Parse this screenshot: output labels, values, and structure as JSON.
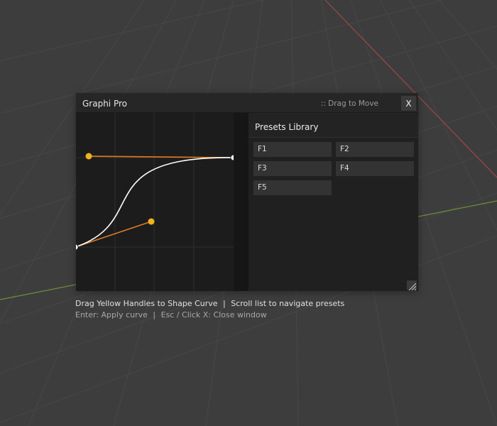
{
  "window": {
    "title": "Graphi Pro",
    "drag_hint": ":: Drag to Move",
    "close_label": "X"
  },
  "curve_editor": {
    "handle_color": "#f2b21e",
    "curve_color": "#ffffff",
    "handle_line_color": "#e07b1f"
  },
  "presets": {
    "title": "Presets Library",
    "items": [
      {
        "label": "F1"
      },
      {
        "label": "F2"
      },
      {
        "label": "F3"
      },
      {
        "label": "F4"
      },
      {
        "label": "F5"
      }
    ]
  },
  "status": {
    "line1_part1": "Drag Yellow Handles to Shape Curve",
    "line1_part2": "Scroll list to navigate presets",
    "line2_part1": "Enter: Apply curve",
    "line2_part2": "Esc / Click X: Close window",
    "separator": "|"
  },
  "icons": {
    "resize": "resize-grip-icon",
    "close": "close-icon"
  }
}
